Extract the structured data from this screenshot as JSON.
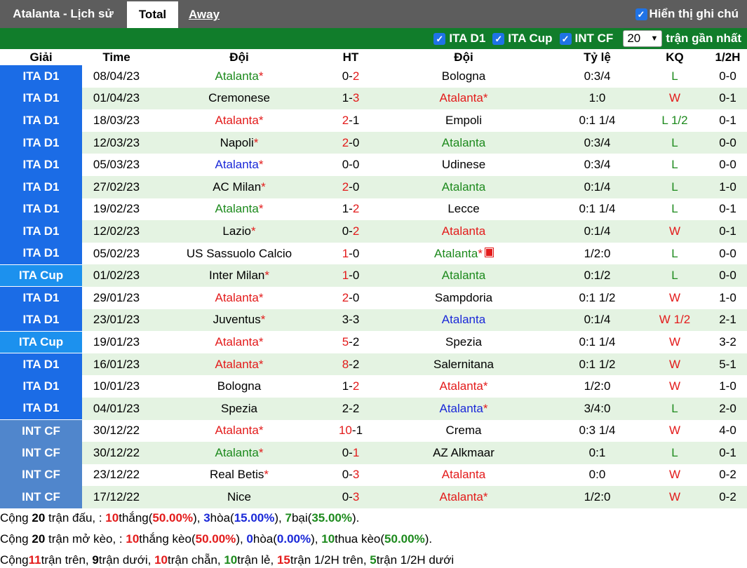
{
  "header": {
    "title": "Atalanta - Lịch sử",
    "tab_total": "Total",
    "tab_away": "Away",
    "show_notes_label": "Hiển thị ghi chú",
    "show_notes_checked": true
  },
  "filters": {
    "items": [
      {
        "label": "ITA D1",
        "checked": true
      },
      {
        "label": "ITA Cup",
        "checked": true
      },
      {
        "label": "INT CF",
        "checked": true
      }
    ],
    "count_value": "20",
    "count_suffix": "trận gần nhất"
  },
  "colors": {
    "topbar": "#5d5d5d",
    "filterbar": "#117d2b",
    "ita_d1": "#1b6ce6",
    "ita_cup": "#1c91ee",
    "int_cf": "#5086cc",
    "win_red": "#e31b1b",
    "home_green": "#1d8a1d",
    "draw_blue": "#1a28d8"
  },
  "table": {
    "columns": [
      "Giải",
      "Time",
      "Đội",
      "HT",
      "Đội",
      "Tỷ lệ",
      "KQ",
      "1/2H"
    ],
    "rows": [
      {
        "league": "ITA D1",
        "lg": "ita",
        "time": "08/04/23",
        "home": "Atalanta",
        "home_c": "green",
        "home_star": true,
        "hs": "0",
        "as": "2",
        "hs_c": "",
        "as_c": "red",
        "away": "Bologna",
        "away_c": "",
        "away_star": false,
        "odds": "0:3/4",
        "res": "L",
        "res_c": "green",
        "half": "0-0"
      },
      {
        "league": "ITA D1",
        "lg": "ita",
        "time": "01/04/23",
        "home": "Cremonese",
        "home_c": "",
        "home_star": false,
        "hs": "1",
        "as": "3",
        "hs_c": "",
        "as_c": "red",
        "away": "Atalanta",
        "away_c": "red",
        "away_star": true,
        "odds": "1:0",
        "res": "W",
        "res_c": "red",
        "half": "0-1"
      },
      {
        "league": "ITA D1",
        "lg": "ita",
        "time": "18/03/23",
        "home": "Atalanta",
        "home_c": "red",
        "home_star": true,
        "hs": "2",
        "as": "1",
        "hs_c": "red",
        "as_c": "",
        "away": "Empoli",
        "away_c": "",
        "away_star": false,
        "odds": "0:1 1/4",
        "res": "L 1/2",
        "res_c": "green",
        "half": "0-1"
      },
      {
        "league": "ITA D1",
        "lg": "ita",
        "time": "12/03/23",
        "home": "Napoli",
        "home_c": "",
        "home_star": true,
        "hs": "2",
        "as": "0",
        "hs_c": "red",
        "as_c": "",
        "away": "Atalanta",
        "away_c": "green",
        "away_star": false,
        "odds": "0:3/4",
        "res": "L",
        "res_c": "green",
        "half": "0-0"
      },
      {
        "league": "ITA D1",
        "lg": "ita",
        "time": "05/03/23",
        "home": "Atalanta",
        "home_c": "blue",
        "home_star": true,
        "hs": "0",
        "as": "0",
        "hs_c": "",
        "as_c": "",
        "away": "Udinese",
        "away_c": "",
        "away_star": false,
        "odds": "0:3/4",
        "res": "L",
        "res_c": "green",
        "half": "0-0"
      },
      {
        "league": "ITA D1",
        "lg": "ita",
        "time": "27/02/23",
        "home": "AC Milan",
        "home_c": "",
        "home_star": true,
        "hs": "2",
        "as": "0",
        "hs_c": "red",
        "as_c": "",
        "away": "Atalanta",
        "away_c": "green",
        "away_star": false,
        "odds": "0:1/4",
        "res": "L",
        "res_c": "green",
        "half": "1-0"
      },
      {
        "league": "ITA D1",
        "lg": "ita",
        "time": "19/02/23",
        "home": "Atalanta",
        "home_c": "green",
        "home_star": true,
        "hs": "1",
        "as": "2",
        "hs_c": "",
        "as_c": "red",
        "away": "Lecce",
        "away_c": "",
        "away_star": false,
        "odds": "0:1 1/4",
        "res": "L",
        "res_c": "green",
        "half": "0-1"
      },
      {
        "league": "ITA D1",
        "lg": "ita",
        "time": "12/02/23",
        "home": "Lazio",
        "home_c": "",
        "home_star": true,
        "hs": "0",
        "as": "2",
        "hs_c": "",
        "as_c": "red",
        "away": "Atalanta",
        "away_c": "red",
        "away_star": false,
        "odds": "0:1/4",
        "res": "W",
        "res_c": "red",
        "half": "0-1"
      },
      {
        "league": "ITA D1",
        "lg": "ita",
        "time": "05/02/23",
        "home": "US Sassuolo Calcio",
        "home_c": "",
        "home_star": false,
        "hs": "1",
        "as": "0",
        "hs_c": "red",
        "as_c": "",
        "away": "Atalanta",
        "away_c": "green",
        "away_star": true,
        "away_card": true,
        "odds": "1/2:0",
        "res": "L",
        "res_c": "green",
        "half": "0-0"
      },
      {
        "league": "ITA Cup",
        "lg": "cup",
        "time": "01/02/23",
        "home": "Inter Milan",
        "home_c": "",
        "home_star": true,
        "hs": "1",
        "as": "0",
        "hs_c": "red",
        "as_c": "",
        "away": "Atalanta",
        "away_c": "green",
        "away_star": false,
        "odds": "0:1/2",
        "res": "L",
        "res_c": "green",
        "half": "0-0"
      },
      {
        "league": "ITA D1",
        "lg": "ita",
        "time": "29/01/23",
        "home": "Atalanta",
        "home_c": "red",
        "home_star": true,
        "hs": "2",
        "as": "0",
        "hs_c": "red",
        "as_c": "",
        "away": "Sampdoria",
        "away_c": "",
        "away_star": false,
        "odds": "0:1 1/2",
        "res": "W",
        "res_c": "red",
        "half": "1-0"
      },
      {
        "league": "ITA D1",
        "lg": "ita",
        "time": "23/01/23",
        "home": "Juventus",
        "home_c": "",
        "home_star": true,
        "hs": "3",
        "as": "3",
        "hs_c": "",
        "as_c": "",
        "away": "Atalanta",
        "away_c": "blue",
        "away_star": false,
        "odds": "0:1/4",
        "res": "W 1/2",
        "res_c": "red",
        "half": "2-1"
      },
      {
        "league": "ITA Cup",
        "lg": "cup",
        "time": "19/01/23",
        "home": "Atalanta",
        "home_c": "red",
        "home_star": true,
        "hs": "5",
        "as": "2",
        "hs_c": "red",
        "as_c": "",
        "away": "Spezia",
        "away_c": "",
        "away_star": false,
        "odds": "0:1 1/4",
        "res": "W",
        "res_c": "red",
        "half": "3-2"
      },
      {
        "league": "ITA D1",
        "lg": "ita",
        "time": "16/01/23",
        "home": "Atalanta",
        "home_c": "red",
        "home_star": true,
        "hs": "8",
        "as": "2",
        "hs_c": "red",
        "as_c": "",
        "away": "Salernitana",
        "away_c": "",
        "away_star": false,
        "odds": "0:1 1/2",
        "res": "W",
        "res_c": "red",
        "half": "5-1"
      },
      {
        "league": "ITA D1",
        "lg": "ita",
        "time": "10/01/23",
        "home": "Bologna",
        "home_c": "",
        "home_star": false,
        "hs": "1",
        "as": "2",
        "hs_c": "",
        "as_c": "red",
        "away": "Atalanta",
        "away_c": "red",
        "away_star": true,
        "odds": "1/2:0",
        "res": "W",
        "res_c": "red",
        "half": "1-0"
      },
      {
        "league": "ITA D1",
        "lg": "ita",
        "time": "04/01/23",
        "home": "Spezia",
        "home_c": "",
        "home_star": false,
        "hs": "2",
        "as": "2",
        "hs_c": "",
        "as_c": "",
        "away": "Atalanta",
        "away_c": "blue",
        "away_star": true,
        "odds": "3/4:0",
        "res": "L",
        "res_c": "green",
        "half": "2-0"
      },
      {
        "league": "INT CF",
        "lg": "int",
        "time": "30/12/22",
        "home": "Atalanta",
        "home_c": "red",
        "home_star": true,
        "hs": "10",
        "as": "1",
        "hs_c": "red",
        "as_c": "",
        "away": "Crema",
        "away_c": "",
        "away_star": false,
        "odds": "0:3 1/4",
        "res": "W",
        "res_c": "red",
        "half": "4-0"
      },
      {
        "league": "INT CF",
        "lg": "int",
        "time": "30/12/22",
        "home": "Atalanta",
        "home_c": "green",
        "home_star": true,
        "hs": "0",
        "as": "1",
        "hs_c": "",
        "as_c": "red",
        "away": "AZ Alkmaar",
        "away_c": "",
        "away_star": false,
        "odds": "0:1",
        "res": "L",
        "res_c": "green",
        "half": "0-1"
      },
      {
        "league": "INT CF",
        "lg": "int",
        "time": "23/12/22",
        "home": "Real Betis",
        "home_c": "",
        "home_star": true,
        "hs": "0",
        "as": "3",
        "hs_c": "",
        "as_c": "red",
        "away": "Atalanta",
        "away_c": "red",
        "away_star": false,
        "odds": "0:0",
        "res": "W",
        "res_c": "red",
        "half": "0-2"
      },
      {
        "league": "INT CF",
        "lg": "int",
        "time": "17/12/22",
        "home": "Nice",
        "home_c": "",
        "home_star": false,
        "hs": "0",
        "as": "3",
        "hs_c": "",
        "as_c": "red",
        "away": "Atalanta",
        "away_c": "red",
        "away_star": true,
        "odds": "1/2:0",
        "res": "W",
        "res_c": "red",
        "half": "0-2"
      }
    ]
  },
  "summary": {
    "line1": {
      "prefix": "Cộng ",
      "count": "20",
      "t1": " trận đấu, : ",
      "wins": "10",
      "t2": "thắng(",
      "wins_pct": "50.00%",
      "t3": "), ",
      "draws": "3",
      "t4": "hòa(",
      "draws_pct": "15.00%",
      "t5": "), ",
      "losses": "7",
      "t6": "bại(",
      "losses_pct": "35.00%",
      "t7": ")."
    },
    "line2": {
      "prefix": "Cộng ",
      "count": "20",
      "t1": " trận mở kèo, : ",
      "wins": "10",
      "t2": "thắng kèo(",
      "wins_pct": "50.00%",
      "t3": "), ",
      "draws": "0",
      "t4": "hòa(",
      "draws_pct": "0.00%",
      "t5": "), ",
      "losses": "10",
      "t6": "thua kèo(",
      "losses_pct": "50.00%",
      "t7": ")."
    },
    "line3": {
      "prefix": "Cộng",
      "over": "11",
      "t1": "trận trên, ",
      "under": "9",
      "t2": "trận dưới, ",
      "even": "10",
      "t3": "trận chẵn, ",
      "odd": "10",
      "t4": "trận lẻ, ",
      "h_over": "15",
      "t5": "trận 1/2H trên, ",
      "h_under": "5",
      "t6": "trận 1/2H dưới"
    }
  }
}
